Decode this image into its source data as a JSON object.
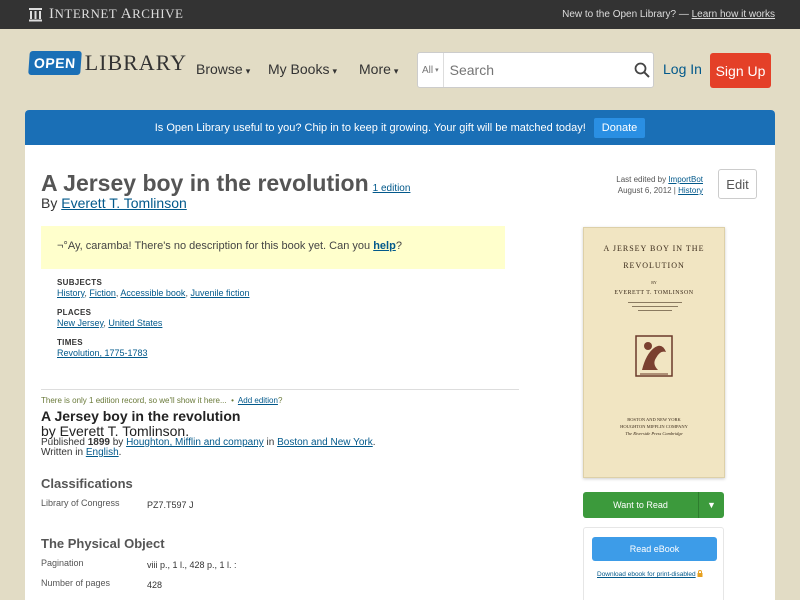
{
  "topbar": {
    "ia_logo_text": "Internet Archive",
    "ia_logo_first": "I",
    "ia_logo_rest1": "NTERNET ",
    "ia_logo_second": "A",
    "ia_logo_rest2": "RCHIVE",
    "new_text": "New to the Open Library? — ",
    "learn_link": "Learn how it works"
  },
  "header": {
    "logo_open": "OPEN",
    "logo_library": "LIBRARY",
    "nav": [
      {
        "label": "Browse"
      },
      {
        "label": "My Books"
      },
      {
        "label": "More"
      }
    ],
    "search": {
      "category": "All",
      "placeholder": "Search"
    },
    "login": "Log In",
    "signup": "Sign Up"
  },
  "banner": {
    "text": "Is Open Library useful to you? Chip in to keep it growing. Your gift will be matched today!",
    "donate": "Donate"
  },
  "book": {
    "title": "A Jersey boy in the revolution",
    "edition_count": "1 edition",
    "by": "By ",
    "author": "Everett T. Tomlinson",
    "last_edited_label": "Last edited by ",
    "last_edited_user": "ImportBot",
    "last_edited_date": "August 6, 2012 | ",
    "history": "History",
    "edit": "Edit",
    "description_prefix": "¬°Ay, caramba! There's no description for this book yet. Can you ",
    "description_help": "help",
    "description_suffix": "?"
  },
  "facets": {
    "subjects_label": "SUBJECTS",
    "subjects": [
      "History",
      "Fiction",
      "Accessible book",
      "Juvenile fiction"
    ],
    "places_label": "PLACES",
    "places": [
      "New Jersey",
      "United States"
    ],
    "times_label": "TIMES",
    "times": [
      "Revolution, 1775-1783"
    ]
  },
  "edition": {
    "note": "There is only 1 edition record, so we'll show it here...",
    "bullet": "•",
    "add_edition": "Add edition",
    "add_suffix": "?",
    "title": "A Jersey boy in the revolution",
    "by": "by Everett T. Tomlinson.",
    "published_label": "Published ",
    "year": "1899",
    "by_word": " by ",
    "publisher": "Houghton, Mifflin and company",
    "in_word": " in ",
    "place": "Boston and New York",
    "period": ".",
    "written_in": "Written in ",
    "language": "English"
  },
  "classifications": {
    "heading": "Classifications",
    "loc_label": "Library of Congress",
    "loc_value": "PZ7.T597 J"
  },
  "physical": {
    "heading": "The Physical Object",
    "pagination_label": "Pagination",
    "pagination_value": "viii p., 1 l., 428 p., 1 l. :",
    "pages_label": "Number of pages",
    "pages_value": "428"
  },
  "cover": {
    "title_line1": "A JERSEY BOY IN THE",
    "title_line2": "REVOLUTION",
    "by": "BY",
    "author": "EVERETT T. TOMLINSON",
    "publisher_line1": "BOSTON AND NEW YORK",
    "publisher_line2": "HOUGHTON MIFFLIN COMPANY",
    "publisher_line3": "The Riverside Press Cambridge"
  },
  "actions": {
    "want_to_read": "Want to Read",
    "read_ebook": "Read eBook",
    "download": "Download ebook for print-disabled"
  },
  "colors": {
    "accent_blue": "#1a6fb6",
    "signup_red": "#e44028",
    "want_green": "#3c9a3c",
    "read_blue": "#3d9ce8"
  }
}
